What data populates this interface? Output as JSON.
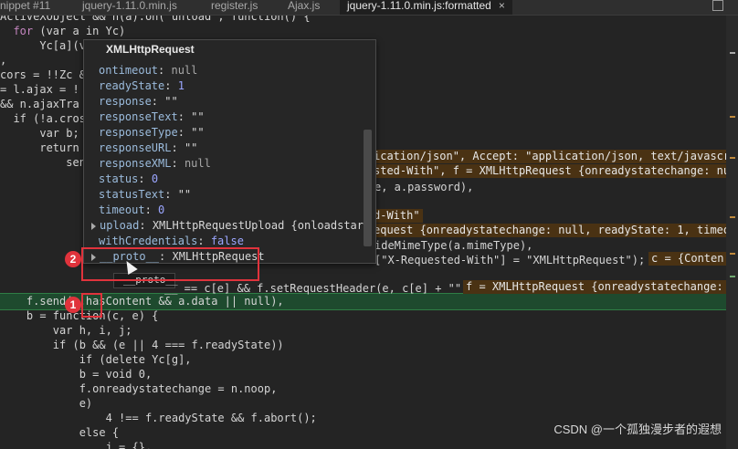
{
  "tabs": [
    {
      "label": "nippet #11",
      "active": false
    },
    {
      "label": "jquery-1.11.0.min.js",
      "active": false
    },
    {
      "label": "register.js",
      "active": false
    },
    {
      "label": "Ajax.js",
      "active": false
    },
    {
      "label": "jquery-1.11.0.min.js:formatted",
      "active": true,
      "close": "×"
    }
  ],
  "code": {
    "l0": "ActiveXObject && n(a).on(\"unload\", function() {",
    "l1a": "  for",
    "l1b": " (var a in Yc)",
    "l2": "      Yc[a](v",
    "l3": ",",
    "l4": "cors = !!Zc &",
    "l5": "= l.ajax = !",
    "l6": "&& n.ajaxTra",
    "l7": "  if (!a.cros",
    "l8": "      var b;",
    "l9": "      return",
    "l10": "          sen",
    "r1": "ication/json\", Accept: \"application/json, text/javascri",
    "r2": "sted-With\", f = XMLHttpRequest {onreadystatechange: null",
    "r3": "e, a.password),",
    "r4": "d-With\"",
    "r5": "equest {onreadystatechange: null, readyState: 1, timeou",
    "r6": "ideMimeType(a.mimeType),",
    "r7": "[\"X-Requested-With\"] = \"XMLHttpRequest\");",
    "r7b": "c = {Conten",
    "r8": "__ == c[e] && f.setRequestHeader(e, c[e] + \"\");",
    "r8b": "f = XMLHttpRequest {onreadystatechange: n",
    "hl": "    f.send(a.hasContent && a.data || null),",
    "b1": "    b = function(c, e) {",
    "b2": "        var h, i, j;",
    "b3": "        if (b && (e || 4 === f.readyState))",
    "b4": "            if (delete Yc[g],",
    "b5": "            b = void 0,",
    "b6": "            f.onreadystatechange = n.noop,",
    "b7": "            e)",
    "b8": "                4 !== f.readyState && f.abort();",
    "b9": "            else {",
    "b10": "                j = {},"
  },
  "popup": {
    "title": "XMLHttpRequest",
    "rows": [
      {
        "key": "ontimeout",
        "value": "null",
        "kind": "null"
      },
      {
        "key": "readyState",
        "value": "1",
        "kind": "num"
      },
      {
        "key": "response",
        "value": "\"\"",
        "kind": "str"
      },
      {
        "key": "responseText",
        "value": "\"\"",
        "kind": "str"
      },
      {
        "key": "responseType",
        "value": "\"\"",
        "kind": "str"
      },
      {
        "key": "responseURL",
        "value": "\"\"",
        "kind": "str"
      },
      {
        "key": "responseXML",
        "value": "null",
        "kind": "null"
      },
      {
        "key": "status",
        "value": "0",
        "kind": "num"
      },
      {
        "key": "statusText",
        "value": "\"\"",
        "kind": "str"
      },
      {
        "key": "timeout",
        "value": "0",
        "kind": "num"
      },
      {
        "key": "upload",
        "value": "XMLHttpRequestUpload {onloadstar",
        "kind": "obj",
        "expandable": true
      },
      {
        "key": "withCredentials",
        "value": "false",
        "kind": "bool"
      },
      {
        "key": "__proto__",
        "value": "XMLHttpRequest",
        "kind": "obj",
        "expandable": true
      }
    ]
  },
  "tooltip": "__proto__",
  "annotations": {
    "badge1": "1",
    "badge2": "2"
  },
  "watermark": "CSDN @一个孤独漫步者的遐想",
  "colors": {
    "highlight_line": "#1e4a2e",
    "inline_value": "#4a3213",
    "annotation_red": "#e0333c"
  }
}
